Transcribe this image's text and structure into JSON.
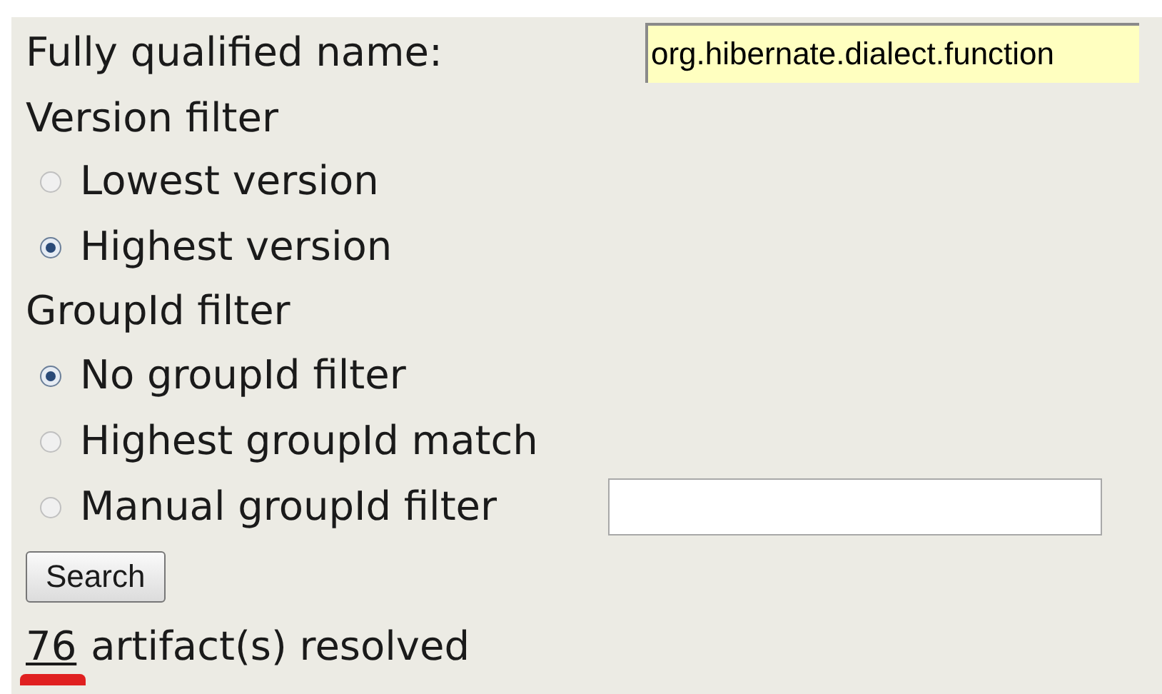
{
  "name_field": {
    "label": "Fully qualified name:",
    "value": "org.hibernate.dialect.function"
  },
  "version_filter": {
    "title": "Version filter",
    "options": [
      {
        "label": "Lowest version",
        "selected": false
      },
      {
        "label": "Highest version",
        "selected": true
      }
    ]
  },
  "groupid_filter": {
    "title": "GroupId filter",
    "options": [
      {
        "label": "No groupId filter",
        "selected": true
      },
      {
        "label": "Highest groupId match",
        "selected": false
      },
      {
        "label": "Manual groupId filter",
        "selected": false,
        "kind": "field"
      }
    ]
  },
  "search_button": "Search",
  "result": {
    "count": "76",
    "text": "artifact(s) resolved"
  }
}
